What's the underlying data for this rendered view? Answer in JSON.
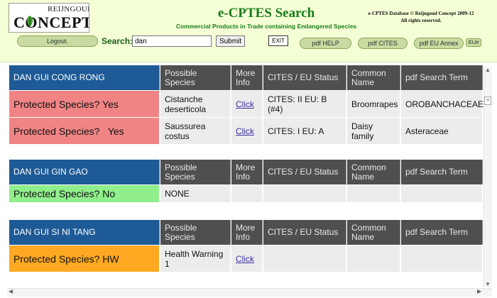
{
  "header": {
    "logo_top": "REIJNGOUD",
    "logo_main": "CONCEPT",
    "title": "e-CPTES Search",
    "subtitle": "Commercial Products in Trade containing Endangered Species",
    "copyright_line1": "e-CPTES Database © Reijngoud Concept 2009-12",
    "copyright_line2": "All rights reserved."
  },
  "toolbar": {
    "logout_label": "Logout.",
    "search_label": "Search:",
    "search_value": "dan",
    "submit_label": "Submit",
    "exit_label": "EXIT",
    "pdf_help_label": "pdf HELP",
    "pdf_cites_label": "pdf CITES",
    "pdf_eu_label": "pdf EU Annex",
    "eu_hash_label": "EU#"
  },
  "columns": {
    "species": "Possible Species",
    "info": "More Info",
    "status": "CITES / EU Status",
    "common": "Common Name",
    "term": "pdf Search Term"
  },
  "results": [
    {
      "name": "DAN GUI CONG RONG",
      "rows": [
        {
          "protected": "Protected Species? Yes",
          "species": "Cistanche deserticola",
          "info": "Click",
          "status": "CITES: II EU: B (#4)",
          "common": "Broomrapes",
          "term": "OROBANCHACEAE"
        },
        {
          "protected": "Protected Species?   Yes",
          "species": "Saussurea costus",
          "info": "Click",
          "status": "CITES: I EU: A",
          "common": "Daisy family",
          "term": "Asteraceae"
        }
      ]
    },
    {
      "name": "DAN GUI GIN GAO",
      "rows": [
        {
          "protected": "Protected Species? No",
          "species": "NONE",
          "info": "",
          "status": "",
          "common": "",
          "term": ""
        }
      ]
    },
    {
      "name": "DAN GUI SI NI TANG",
      "rows": [
        {
          "protected": "Protected Species? HW",
          "species": "Health Warning 1",
          "info": "Click",
          "status": "",
          "common": "",
          "term": ""
        }
      ]
    }
  ],
  "colors": {
    "header_bg": "#f4ffd6",
    "name_header": "#1e5a96",
    "column_header": "#4f4f4f",
    "protected_yes": "#f08484",
    "protected_no": "#90ee8c",
    "protected_hw": "#ffa822",
    "title_green": "#1a7b1a"
  },
  "icons": {
    "logo": "leaf-logo-icon",
    "scroll_up": "arrow-up-icon",
    "scroll_down": "arrow-down-icon",
    "scroll_left": "arrow-left-icon",
    "scroll_right": "arrow-right-icon",
    "scroll_thumb": "scroll-grip-icon"
  }
}
